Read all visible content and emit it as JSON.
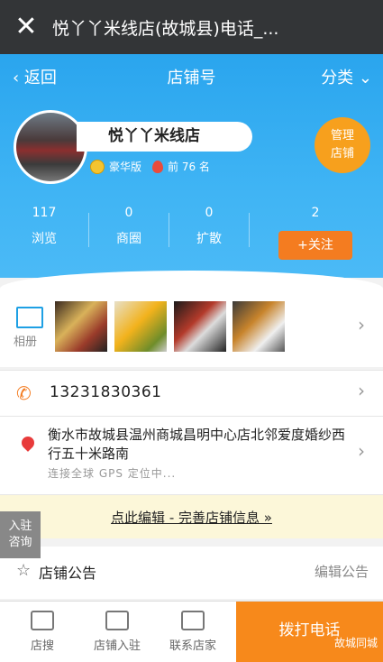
{
  "window": {
    "title": "悦丫丫米线店(故城县)电话_..."
  },
  "nav": {
    "back_label": "返回",
    "center_label": "店铺号",
    "category_label": "分类"
  },
  "store": {
    "name": "悦丫丫米线店",
    "level_label": "豪华版",
    "rank_label": "前 76 名",
    "manage_label_1": "管理",
    "manage_label_2": "店铺"
  },
  "stats": [
    {
      "value": "117",
      "label": "浏览"
    },
    {
      "value": "0",
      "label": "商圈"
    },
    {
      "value": "0",
      "label": "扩散"
    },
    {
      "value": "2",
      "label": ""
    }
  ],
  "follow_label": "+关注",
  "album": {
    "label": "相册"
  },
  "phone": {
    "number": "13231830361"
  },
  "address": {
    "text": "衡水市故城县温州商城昌明中心店北邻爱度婚纱西行五十米路南",
    "gps_status": "连接全球 GPS 定位中..."
  },
  "edit_prompt": "点此编辑 - 完善店铺信息 »",
  "side_button": {
    "line1": "入驻",
    "line2": "咨询"
  },
  "notice": {
    "title": "店铺公告",
    "edit_label": "编辑公告"
  },
  "bottom_tabs": [
    {
      "label": "店搜"
    },
    {
      "label": "店铺入驻"
    },
    {
      "label": "联系店家"
    }
  ],
  "call_label": "拨打电话",
  "watermark": "故城同城"
}
